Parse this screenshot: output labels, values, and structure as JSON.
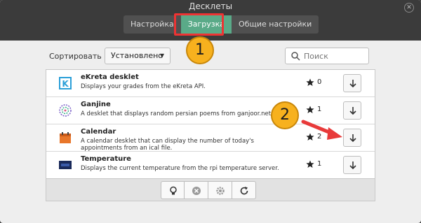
{
  "window": {
    "title": "Десклеты"
  },
  "tabs": [
    {
      "label": "Настройка"
    },
    {
      "label": "Загрузка"
    },
    {
      "label": "Общие настройки"
    }
  ],
  "sort": {
    "label": "Сортировать по",
    "selected": "Установлено"
  },
  "search": {
    "placeholder": "Поиск",
    "value": ""
  },
  "desklets": [
    {
      "name": "eKreta desklet",
      "description": "Displays your grades from the eKreta API.",
      "stars": "0"
    },
    {
      "name": "Ganjine",
      "description": "A desklet that displays random persian poems from ganjoor.net.",
      "stars": "1"
    },
    {
      "name": "Calendar",
      "description": "A calendar desklet that can display the number of today's appointments from an ical file.",
      "stars": "2"
    },
    {
      "name": "Temperature",
      "description": "Displays the current temperature from the rpi temperature server.",
      "stars": "1"
    }
  ],
  "annotations": {
    "badge1": "1",
    "badge2": "2"
  },
  "colors": {
    "active_tab": "#5aaa88",
    "highlight": "#e33333",
    "badge": "#f7b11e",
    "arrow": "#e83a3a"
  }
}
